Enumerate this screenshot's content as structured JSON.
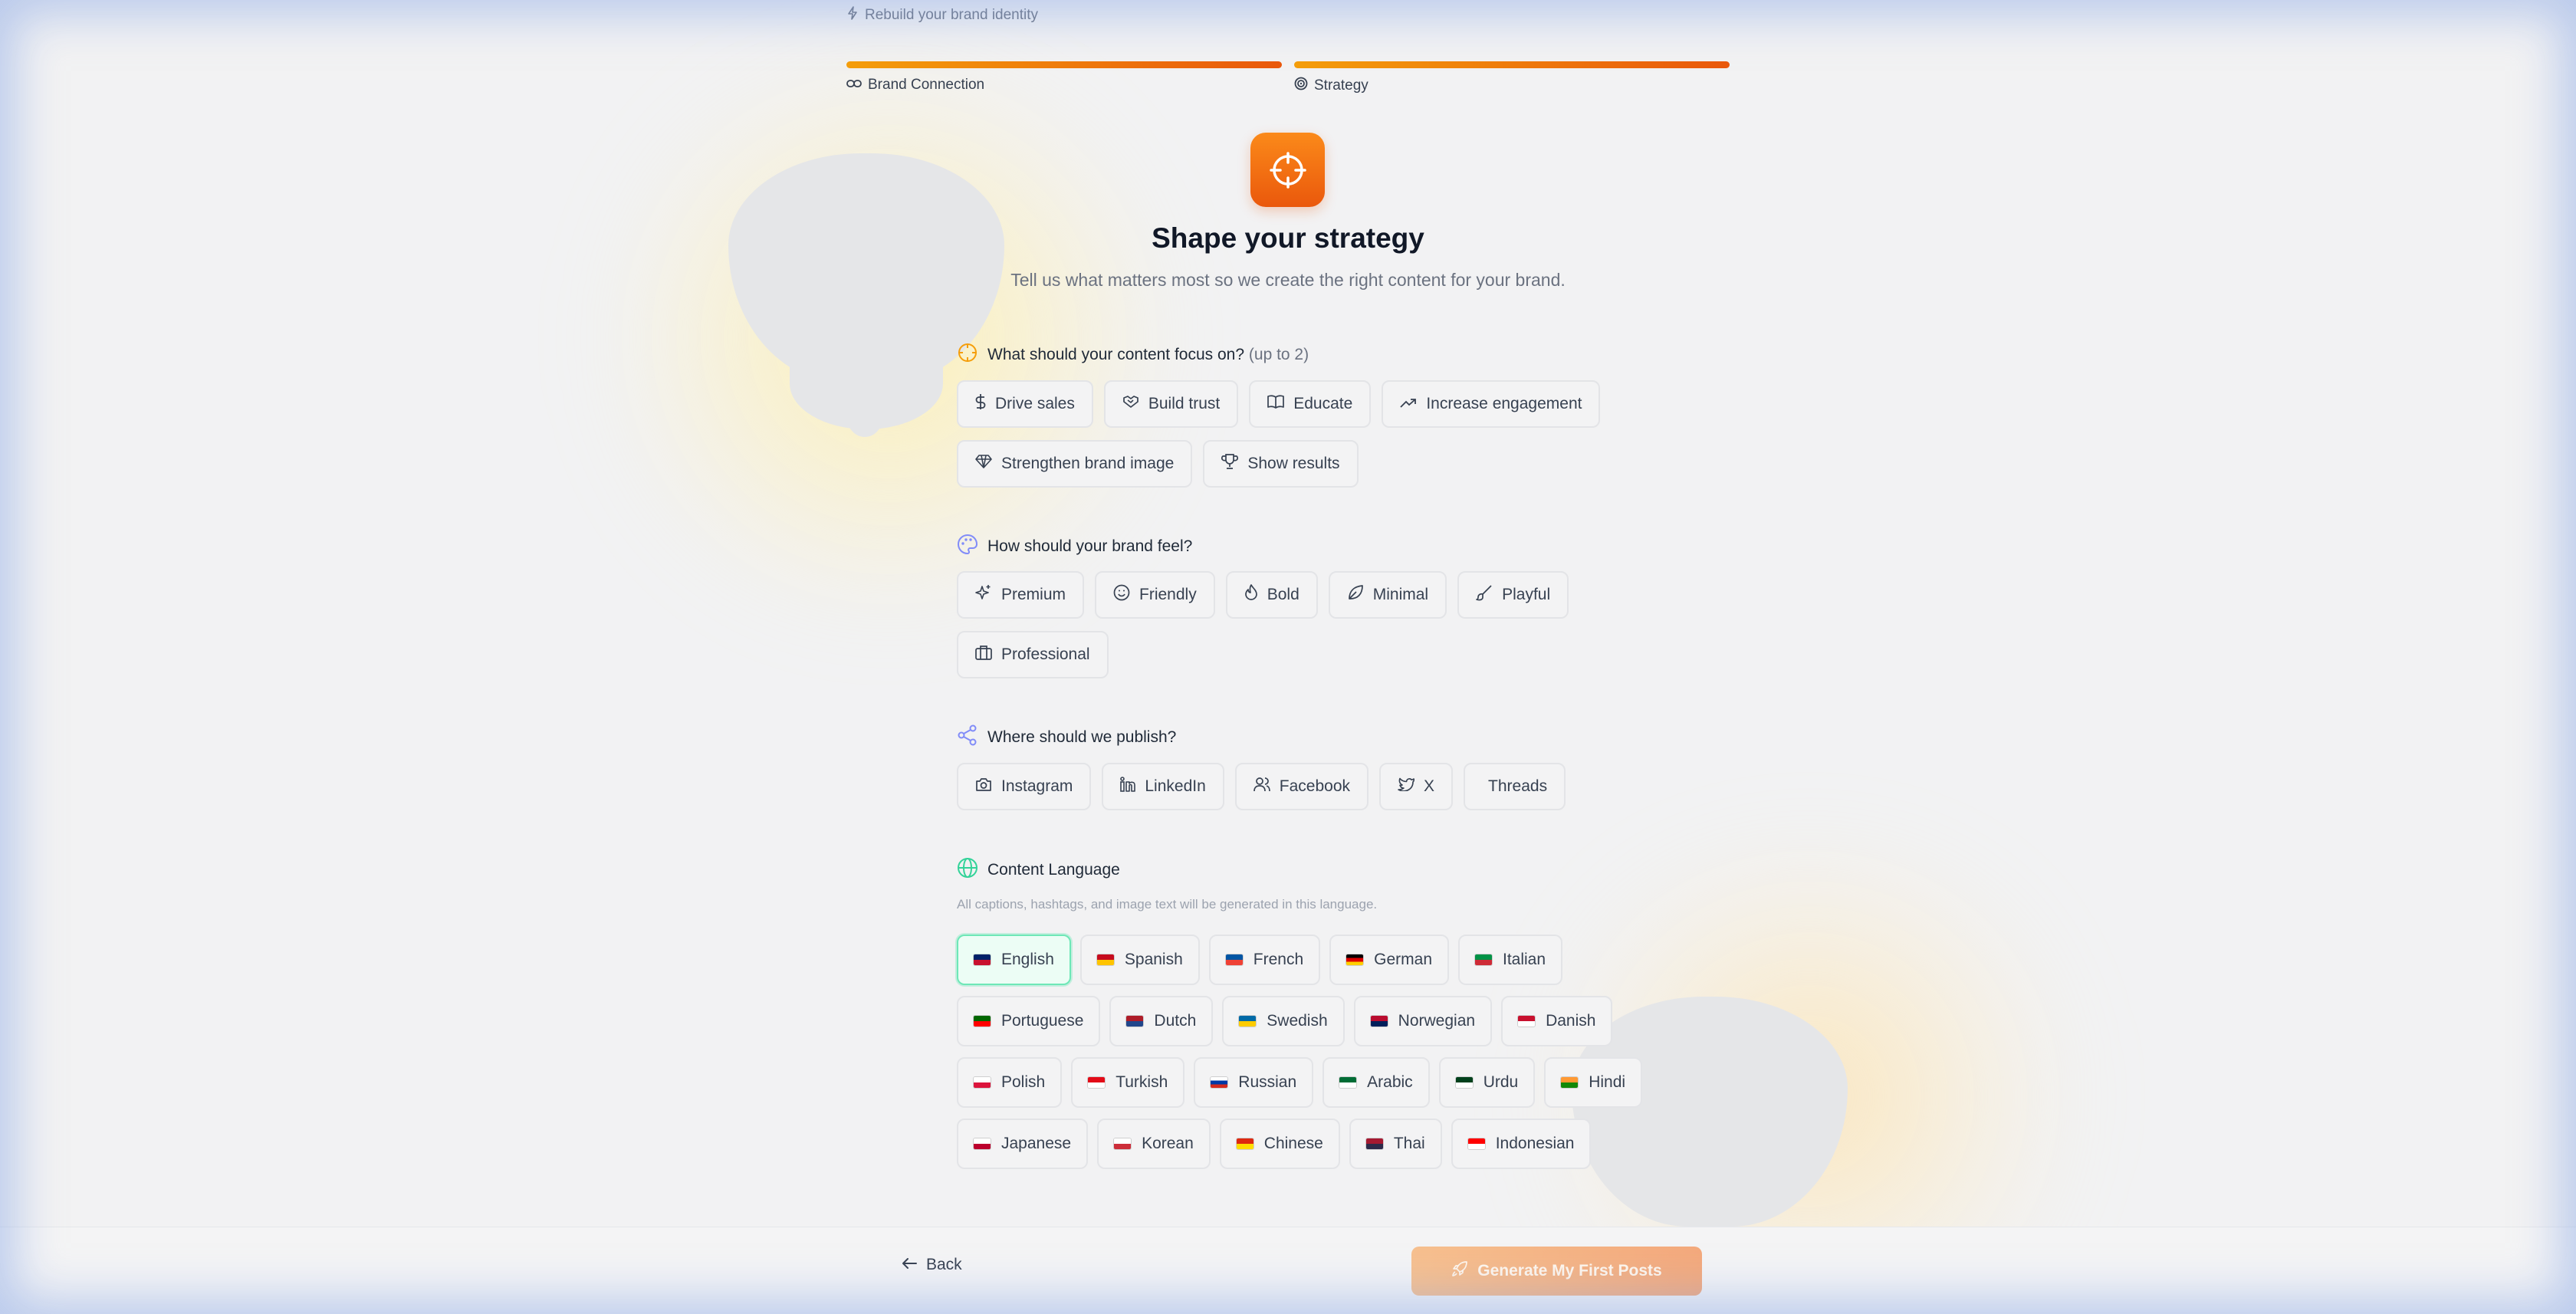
{
  "topbar": {
    "text": "Rebuild your brand identity",
    "icon": "sparkle-icon"
  },
  "steps": [
    {
      "label": "Brand Connection",
      "icon": "link-icon",
      "progress": 1.0
    },
    {
      "label": "Strategy",
      "icon": "target-icon",
      "progress": 1.0
    }
  ],
  "hero": {
    "icon": "crosshair-icon",
    "title": "Shape your strategy",
    "subtitle": "Tell us what matters most so we create the right content for your brand."
  },
  "focus": {
    "title": "What should your content focus on?",
    "note": "(up to 2)",
    "options": [
      {
        "label": "Drive sales",
        "icon": "dollar-icon"
      },
      {
        "label": "Build trust",
        "icon": "handshake-icon"
      },
      {
        "label": "Educate",
        "icon": "book-icon"
      },
      {
        "label": "Increase engagement",
        "icon": "trending-up-icon"
      },
      {
        "label": "Strengthen brand image",
        "icon": "diamond-icon"
      },
      {
        "label": "Show results",
        "icon": "trophy-icon"
      }
    ]
  },
  "feel": {
    "title": "How should your brand feel?",
    "options": [
      {
        "label": "Premium",
        "icon": "sparkles-icon"
      },
      {
        "label": "Friendly",
        "icon": "smile-icon"
      },
      {
        "label": "Bold",
        "icon": "flame-icon"
      },
      {
        "label": "Minimal",
        "icon": "leaf-icon"
      },
      {
        "label": "Playful",
        "icon": "brush-icon"
      },
      {
        "label": "Professional",
        "icon": "briefcase-icon"
      }
    ]
  },
  "publish": {
    "title": "Where should we publish?",
    "options": [
      {
        "label": "Instagram",
        "icon": "camera-icon"
      },
      {
        "label": "LinkedIn",
        "icon": "linkedin-icon"
      },
      {
        "label": "Facebook",
        "icon": "users-icon"
      },
      {
        "label": "X",
        "icon": "twitter-icon"
      },
      {
        "label": "Threads",
        "icon": ""
      }
    ]
  },
  "language": {
    "title": "Content Language",
    "hint": "All captions, hashtags, and image text will be generated in this language.",
    "selected": "English",
    "options": [
      {
        "label": "English",
        "flag": [
          "#012169",
          "#c8102e"
        ]
      },
      {
        "label": "Spanish",
        "flag": [
          "#c60b1e",
          "#ffc400"
        ]
      },
      {
        "label": "French",
        "flag": [
          "#0055a4",
          "#ef4135"
        ]
      },
      {
        "label": "German",
        "flag": [
          "#000000",
          "#dd0000",
          "#ffce00"
        ]
      },
      {
        "label": "Italian",
        "flag": [
          "#009246",
          "#ce2b37"
        ]
      },
      {
        "label": "Portuguese",
        "flag": [
          "#006600",
          "#ff0000"
        ]
      },
      {
        "label": "Dutch",
        "flag": [
          "#ae1c28",
          "#21468b"
        ]
      },
      {
        "label": "Swedish",
        "flag": [
          "#006aa7",
          "#fecc00"
        ]
      },
      {
        "label": "Norwegian",
        "flag": [
          "#ba0c2f",
          "#00205b"
        ]
      },
      {
        "label": "Danish",
        "flag": [
          "#c8102e",
          "#ffffff"
        ]
      },
      {
        "label": "Polish",
        "flag": [
          "#ffffff",
          "#dc143c"
        ]
      },
      {
        "label": "Turkish",
        "flag": [
          "#e30a17",
          "#ffffff"
        ]
      },
      {
        "label": "Russian",
        "flag": [
          "#ffffff",
          "#0039a6",
          "#d52b1e"
        ]
      },
      {
        "label": "Arabic",
        "flag": [
          "#006c35",
          "#ffffff"
        ]
      },
      {
        "label": "Urdu",
        "flag": [
          "#01411c",
          "#ffffff"
        ]
      },
      {
        "label": "Hindi",
        "flag": [
          "#ff9933",
          "#138808"
        ]
      },
      {
        "label": "Japanese",
        "flag": [
          "#ffffff",
          "#bc002d"
        ]
      },
      {
        "label": "Korean",
        "flag": [
          "#ffffff",
          "#cd2e3a"
        ]
      },
      {
        "label": "Chinese",
        "flag": [
          "#de2910",
          "#ffde00"
        ]
      },
      {
        "label": "Thai",
        "flag": [
          "#a51931",
          "#2d2a4a"
        ]
      },
      {
        "label": "Indonesian",
        "flag": [
          "#ff0000",
          "#ffffff"
        ]
      }
    ]
  },
  "footer": {
    "back_label": "Back",
    "generate_label": "Generate My First Posts"
  },
  "colors": {
    "accent": "#ea580c",
    "selected_border": "#6ee7b7"
  }
}
